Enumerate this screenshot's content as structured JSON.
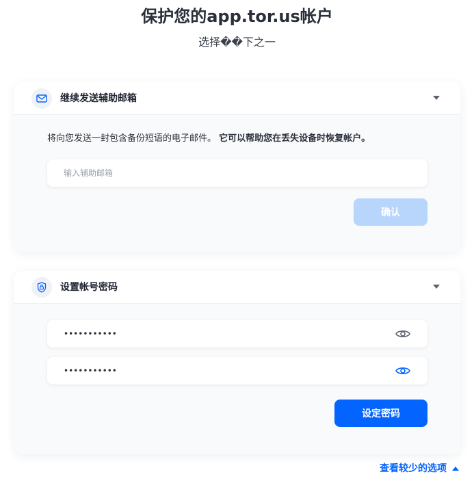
{
  "page": {
    "title": "保护您的app.tor.us帐户",
    "subtitle": "选择��下之一"
  },
  "email_card": {
    "icon": "mail-icon",
    "title": "继续发送辅助邮箱",
    "description": "将向您发送一封包含备份短语的电子邮件。",
    "description_bold": "它可以帮助您在丢失设备时恢复帐户。",
    "input_placeholder": "输入辅助邮箱",
    "input_value": "",
    "confirm_label": "确认"
  },
  "password_card": {
    "icon": "lock-shield-icon",
    "title": "设置帐号密码",
    "password_value": "•••••••••••",
    "confirm_password_value": "•••••••••••",
    "set_password_label": "设定密码"
  },
  "footer": {
    "see_less_label": "查看较少的选项"
  },
  "colors": {
    "accent": "#0364ff",
    "accent_disabled": "#b8d6fb",
    "eye_inactive": "#5b6270"
  }
}
